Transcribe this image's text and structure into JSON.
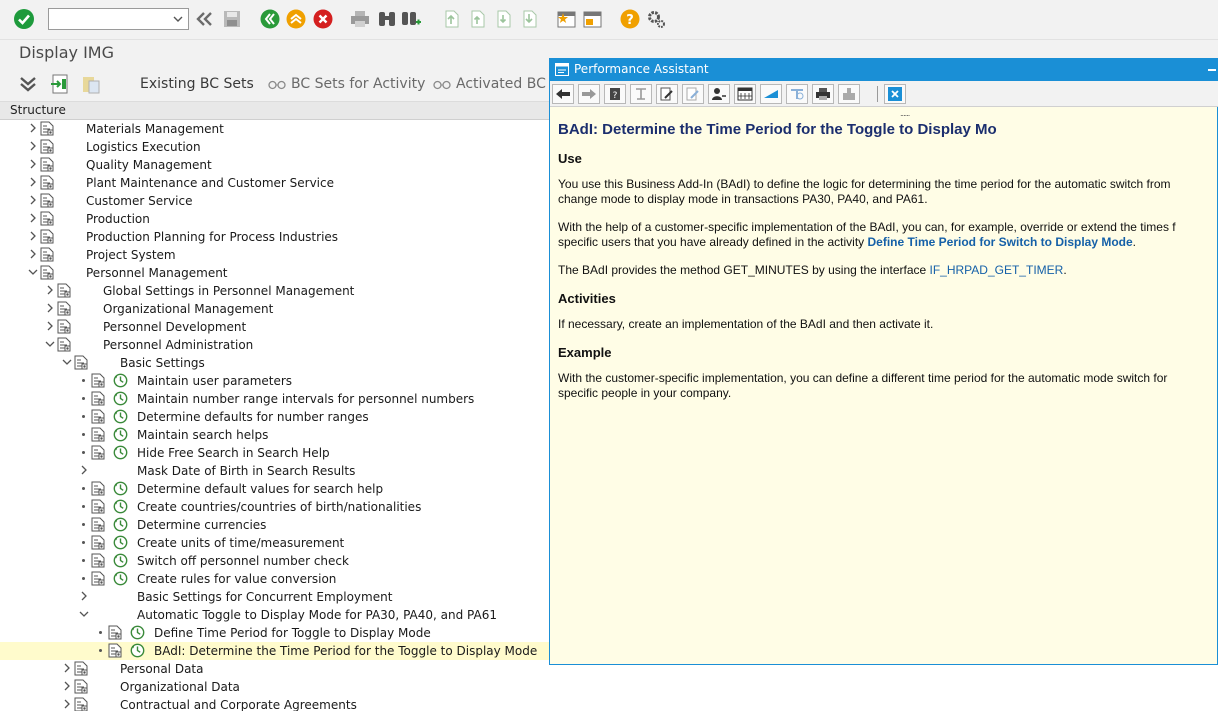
{
  "toolbar": {
    "command_field_value": "",
    "icons": [
      "enter-icon",
      "back-icon",
      "save-icon",
      "nav-back-icon",
      "exit-icon",
      "cancel-icon",
      "print-icon",
      "find-icon",
      "find-next-icon",
      "first-page-icon",
      "prev-page-icon",
      "next-page-icon",
      "last-page-icon",
      "new-session-icon",
      "shortcut-icon",
      "help-icon",
      "settings-icon"
    ]
  },
  "title": {
    "text": "Display IMG"
  },
  "app_toolbar": {
    "existing_bc_sets": "Existing BC Sets",
    "bc_sets_for_activity": "BC Sets for Activity",
    "activated_bc_sets": "Activated BC Se"
  },
  "structure": {
    "header": "Structure",
    "rows": [
      {
        "label": "Materials Management"
      },
      {
        "label": "Logistics Execution"
      },
      {
        "label": "Quality Management"
      },
      {
        "label": "Plant Maintenance and Customer Service"
      },
      {
        "label": "Customer Service"
      },
      {
        "label": "Production"
      },
      {
        "label": "Production Planning for Process Industries"
      },
      {
        "label": "Project System"
      },
      {
        "label": "Personnel Management"
      },
      {
        "label": "Global Settings in Personnel Management"
      },
      {
        "label": "Organizational Management"
      },
      {
        "label": "Personnel Development"
      },
      {
        "label": "Personnel Administration"
      },
      {
        "label": "Basic Settings"
      },
      {
        "label": "Maintain user parameters"
      },
      {
        "label": "Maintain number range intervals for personnel numbers"
      },
      {
        "label": "Determine defaults for number ranges"
      },
      {
        "label": "Maintain search helps"
      },
      {
        "label": "Hide Free Search in Search Help"
      },
      {
        "label": "Mask Date of Birth in Search Results"
      },
      {
        "label": "Determine default values for search help"
      },
      {
        "label": "Create countries/countries of birth/nationalities"
      },
      {
        "label": "Determine currencies"
      },
      {
        "label": "Create units of time/measurement"
      },
      {
        "label": "Switch off personnel number check"
      },
      {
        "label": "Create rules for value conversion"
      },
      {
        "label": "Basic Settings for Concurrent Employment"
      },
      {
        "label": "Automatic Toggle to Display Mode for PA30, PA40, and PA61"
      },
      {
        "label": "Define Time Period for Toggle to Display Mode"
      },
      {
        "label": "BAdI: Determine the Time Period for the Toggle to Display Mode"
      },
      {
        "label": "Personal Data"
      },
      {
        "label": "Organizational Data"
      },
      {
        "label": "Contractual and Corporate Agreements"
      }
    ]
  },
  "assistant": {
    "title": "Performance Assistant",
    "heading": "BAdI: Determine the Time Period for the Toggle to Display Mo",
    "use_title": "Use",
    "use_p1_line1": "You use this Business Add-In (BAdI) to define the logic for determining the time period for the automatic switch from",
    "use_p1_line2": "change mode to display mode in transactions PA30, PA40, and PA61.",
    "use_p2_line1": "With the help of a customer-specific implementation of the BAdI, you can, for example, override or extend the times f",
    "use_p2_line2_pre": "specific users that you have already defined in the activity ",
    "use_p2_link": "Define Time Period for Switch to Display Mode",
    "use_p2_line2_post": ".",
    "use_p3_pre": "The BAdI provides the method GET_MINUTES by using the interface ",
    "use_p3_link": "IF_HRPAD_GET_TIMER",
    "use_p3_post": ".",
    "activities_title": "Activities",
    "activities_p": "If necessary, create an implementation of the BAdI and then activate it.",
    "example_title": "Example",
    "example_p_line1": "With the customer-specific implementation, you can define a different time period for the automatic mode switch for",
    "example_p_line2": "specific people in your company.",
    "grip": "......"
  },
  "colors": {
    "accent": "#1a8fd6",
    "selected_row": "#fffbcc",
    "assistant_bg": "#fffde6",
    "heading": "#1b2e6e",
    "link": "#1560a8"
  }
}
